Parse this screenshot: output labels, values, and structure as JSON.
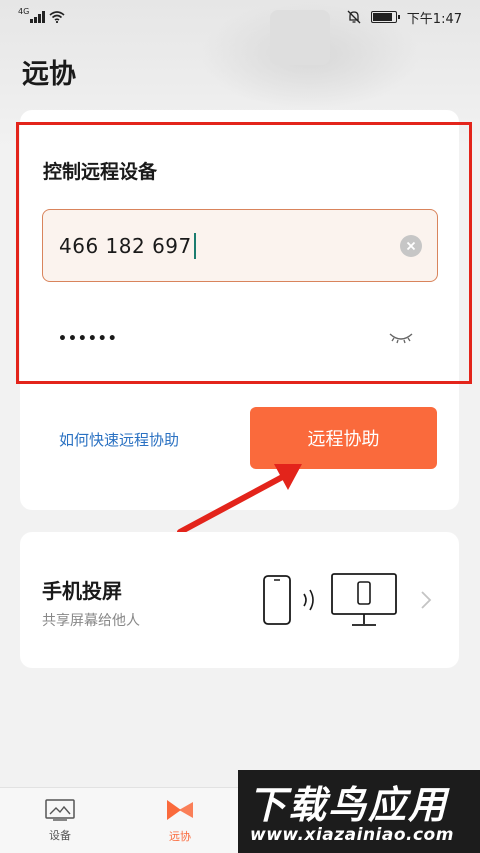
{
  "status_bar": {
    "network": "4G",
    "time": "下午1:47"
  },
  "page": {
    "title": "远协"
  },
  "remote_control": {
    "section_title": "控制远程设备",
    "device_code": "466 182 697",
    "password_masked": "••••••",
    "help_link": "如何快速远程协助",
    "assist_button": "远程协助"
  },
  "screen_cast": {
    "title": "手机投屏",
    "subtitle": "共享屏幕给他人"
  },
  "bottom_nav": {
    "items": [
      {
        "label": "设备",
        "icon": "device-icon",
        "active": false
      },
      {
        "label": "远协",
        "icon": "remote-assist-icon",
        "active": true
      }
    ]
  },
  "watermark": {
    "title": "下载鸟应用",
    "url": "www.xiazainiao.com"
  },
  "colors": {
    "accent": "#fa6a3c",
    "link": "#2a71c2",
    "annotation": "#e3241b"
  }
}
